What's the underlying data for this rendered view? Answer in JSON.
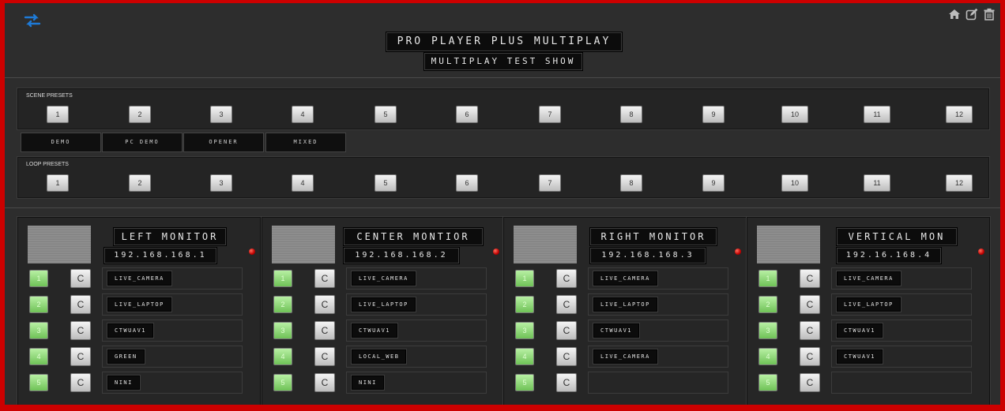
{
  "header": {
    "title": "PRO PLAYER PLUS MULTIPLAY",
    "subtitle": "MULTIPLAY TEST SHOW"
  },
  "icons": {
    "swap": "swap-icon",
    "home": "home-icon",
    "edit": "edit-icon",
    "trash": "trash-icon"
  },
  "colors": {
    "frame_border": "#cc0000",
    "background": "#2d2d2d",
    "accent_blue": "#1e7ad6",
    "preset_green": "#86d46c",
    "status_led": "#cc0000"
  },
  "scene_presets": {
    "label": "SCENE PRESETS",
    "buttons": [
      "1",
      "2",
      "3",
      "4",
      "5",
      "6",
      "7",
      "8",
      "9",
      "10",
      "11",
      "12"
    ]
  },
  "named_scenes": [
    "DEMO",
    "PC DEMO",
    "OPENER",
    "MIXED"
  ],
  "loop_presets": {
    "label": "LOOP PRESETS",
    "buttons": [
      "1",
      "2",
      "3",
      "4",
      "5",
      "6",
      "7",
      "8",
      "9",
      "10",
      "11",
      "12"
    ]
  },
  "monitors": [
    {
      "name": "LEFT MONITOR",
      "ip": "192.168.168.1",
      "rows": [
        {
          "num": "1",
          "reload": "C",
          "source": "LIVE_CAMERA"
        },
        {
          "num": "2",
          "reload": "C",
          "source": "LIVE_LAPTOP"
        },
        {
          "num": "3",
          "reload": "C",
          "source": "CTWUAV1"
        },
        {
          "num": "4",
          "reload": "C",
          "source": "GREEN"
        },
        {
          "num": "5",
          "reload": "C",
          "source": "NINI"
        }
      ]
    },
    {
      "name": "CENTER MONTIOR",
      "ip": "192.168.168.2",
      "rows": [
        {
          "num": "1",
          "reload": "C",
          "source": "LIVE_CAMERA"
        },
        {
          "num": "2",
          "reload": "C",
          "source": "LIVE_LAPTOP"
        },
        {
          "num": "3",
          "reload": "C",
          "source": "CTWUAV1"
        },
        {
          "num": "4",
          "reload": "C",
          "source": "LOCAL_WEB"
        },
        {
          "num": "5",
          "reload": "C",
          "source": "NINI"
        }
      ]
    },
    {
      "name": "RIGHT MONITOR",
      "ip": "192.168.168.3",
      "rows": [
        {
          "num": "1",
          "reload": "C",
          "source": "LIVE_CAMERA"
        },
        {
          "num": "2",
          "reload": "C",
          "source": "LIVE_LAPTOP"
        },
        {
          "num": "3",
          "reload": "C",
          "source": "CTWUAV1"
        },
        {
          "num": "4",
          "reload": "C",
          "source": "LIVE_CAMERA"
        },
        {
          "num": "5",
          "reload": "C",
          "source": ""
        }
      ]
    },
    {
      "name": "VERTICAL MON",
      "ip": "192.16.168.4",
      "rows": [
        {
          "num": "1",
          "reload": "C",
          "source": "LIVE_CAMERA"
        },
        {
          "num": "2",
          "reload": "C",
          "source": "LIVE_LAPTOP"
        },
        {
          "num": "3",
          "reload": "C",
          "source": "CTWUAV1"
        },
        {
          "num": "4",
          "reload": "C",
          "source": "CTWUAV1"
        },
        {
          "num": "5",
          "reload": "C",
          "source": ""
        }
      ]
    }
  ]
}
